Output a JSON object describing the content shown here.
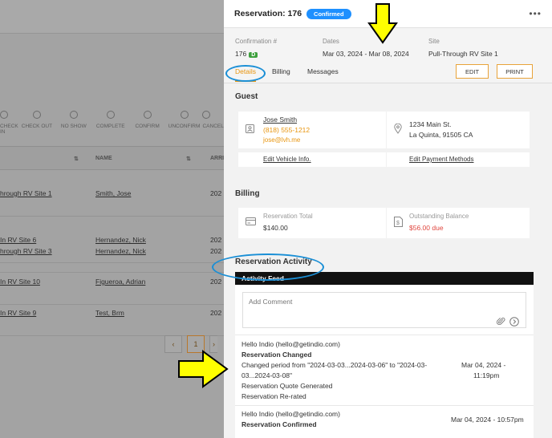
{
  "background": {
    "toolbar": [
      "CHECK IN",
      "CHECK OUT",
      "NO SHOW",
      "COMPLETE",
      "CONFIRM",
      "UNCONFIRM",
      "CANCEL"
    ],
    "columns": {
      "name": "NAME",
      "arrival": "ARRI"
    },
    "rows": [
      {
        "site": "hrough RV Site 1",
        "name": "Smith, Jose",
        "arrival": "202"
      },
      {
        "site": "In RV Site 6",
        "name": "Hernandez, Nick",
        "arrival": "202"
      },
      {
        "site": "hrough RV Site 3",
        "name": "Hernandez, Nick",
        "arrival": "202"
      },
      {
        "site": "In RV Site 10",
        "name": "Figueroa, Adrian",
        "arrival": "202"
      },
      {
        "site": "In RV Site 9",
        "name": "Test, Brm",
        "arrival": "202"
      }
    ],
    "pager": {
      "current": "1"
    }
  },
  "drawer": {
    "title": "Reservation: 176",
    "status_badge": "Confirmed",
    "menu_icon": "more-horizontal-icon",
    "confirmation": {
      "label": "Confirmation #",
      "value": "176",
      "badge": "D"
    },
    "dates": {
      "label": "Dates",
      "value": "Mar 03, 2024 - Mar 08, 2024"
    },
    "site": {
      "label": "Site",
      "value": "Pull-Through RV Site 1"
    },
    "tabs": [
      "Details",
      "Billing",
      "Messages"
    ],
    "active_tab": "Details",
    "edit_label": "EDIT",
    "print_label": "PRINT",
    "guest": {
      "title": "Guest",
      "name": "Jose Smith",
      "phone": "(818) 555-1212",
      "email": "jose@lvh.me",
      "address1": "1234 Main St.",
      "address2": "La Quinta, 91505 CA",
      "edit_vehicle": "Edit Vehicle Info.",
      "edit_payment": "Edit Payment Methods"
    },
    "billing": {
      "title": "Billing",
      "total_label": "Reservation Total",
      "total_value": "$140.00",
      "balance_label": "Outstanding Balance",
      "balance_value": "$56.00 due"
    },
    "activity": {
      "title": "Reservation Activity",
      "feed_title": "Activity Feed",
      "comment_placeholder": "Add Comment",
      "entries": [
        {
          "author": "Hello Indio (hello@getindio.com)",
          "event": "Reservation Changed",
          "detail1": "Changed period from \"2024-03-03...2024-03-06\" to \"2024-03-",
          "detail2": "03...2024-03-08\"",
          "detail3": "Reservation Quote Generated",
          "detail4": "Reservation Re-rated",
          "date1": "Mar 04, 2024 -",
          "date2": "11:19pm"
        },
        {
          "author": "Hello Indio (hello@getindio.com)",
          "event": "Reservation Confirmed",
          "date": "Mar 04, 2024 - 10:57pm"
        }
      ]
    }
  },
  "colors": {
    "accent": "#e8950f",
    "badge": "#1e90ff",
    "annotation_circle": "#1a8fd6",
    "annotation_arrow": "#ffff00"
  }
}
